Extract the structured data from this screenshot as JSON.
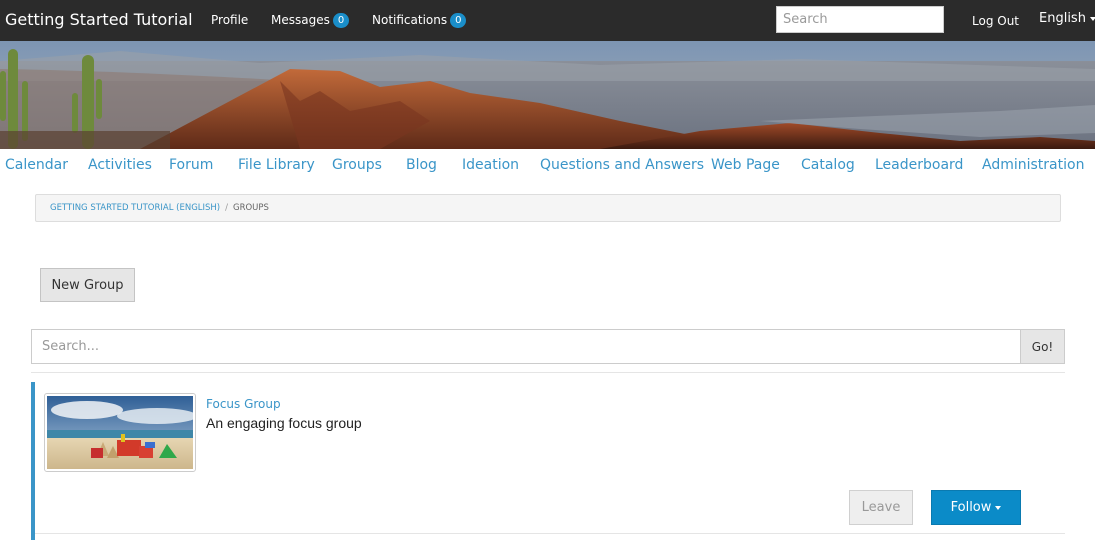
{
  "header": {
    "brand": "Getting Started Tutorial",
    "profile_label": "Profile",
    "messages_label": "Messages",
    "messages_count": "0",
    "notifications_label": "Notifications",
    "notifications_count": "0",
    "search_placeholder": "Search",
    "logout_label": "Log Out",
    "language_label": "English"
  },
  "main_nav": {
    "items": [
      "Calendar",
      "Activities",
      "Forum",
      "File Library",
      "Groups",
      "Blog",
      "Ideation",
      "Questions and Answers",
      "Web Page",
      "Catalog",
      "Leaderboard",
      "Administration"
    ]
  },
  "breadcrumb": {
    "root": "GETTING STARTED TUTORIAL (ENGLISH)",
    "separator": "/",
    "current": "GROUPS"
  },
  "actions": {
    "new_group_label": "New Group"
  },
  "group_search": {
    "placeholder": "Search...",
    "go_label": "Go!"
  },
  "groups": [
    {
      "name": "Focus Group",
      "description": "An engaging focus group",
      "leave_label": "Leave",
      "follow_label": "Follow"
    }
  ],
  "icons": {
    "language_caret": "chevron-down-icon",
    "follow_caret": "chevron-down-icon"
  },
  "colors": {
    "topbar_bg": "#2b2b2b",
    "link": "#3a95c8",
    "badge": "#1a8ec9",
    "follow_button": "#0b8bc8"
  }
}
